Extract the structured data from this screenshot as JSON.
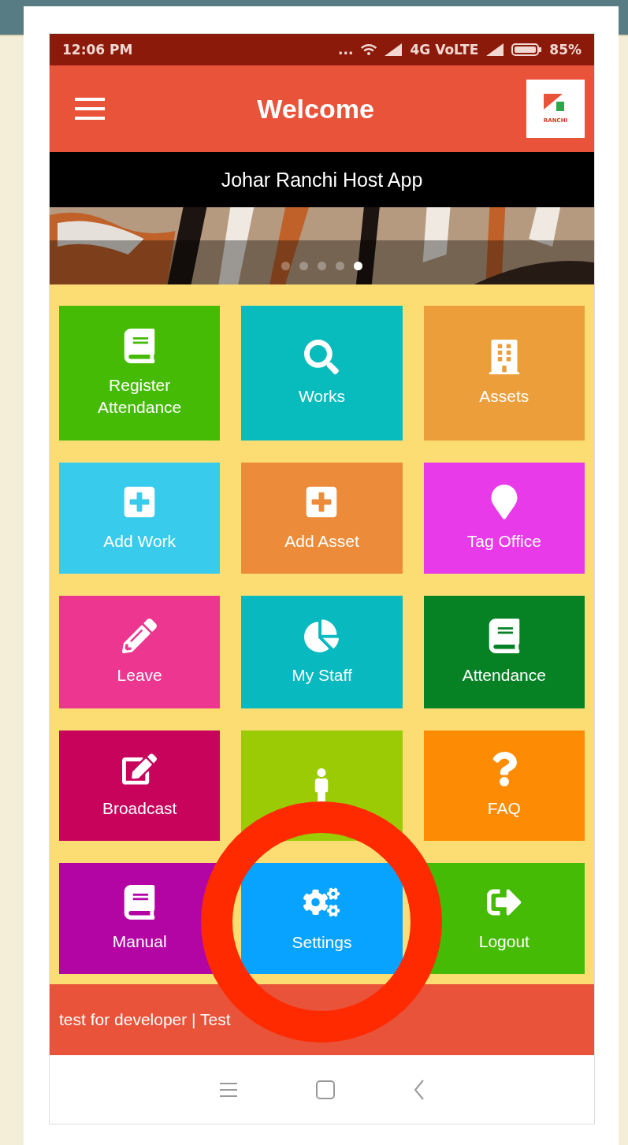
{
  "status_bar": {
    "time": "12:06 PM",
    "dots": "...",
    "network": "4G VoLTE",
    "battery": "85%"
  },
  "header": {
    "title": "Welcome",
    "logo_text": "RANCHI"
  },
  "app_title": "Johar Ranchi Host App",
  "banner": {
    "kind": "picture",
    "dots": [
      {
        "selected": false
      },
      {
        "selected": false
      },
      {
        "selected": false
      },
      {
        "selected": false
      },
      {
        "selected": true
      }
    ]
  },
  "tiles": [
    {
      "label": "Register Attendance",
      "color": "#45bb05"
    },
    {
      "label": "Works",
      "color": "#08bbbd"
    },
    {
      "label": "Assets",
      "color": "#eb9e3a"
    },
    {
      "label": "Add Work",
      "color": "#39cbec"
    },
    {
      "label": "Add Asset",
      "color": "#ec8c3a"
    },
    {
      "label": "Tag Office",
      "color": "#e83ae8"
    },
    {
      "label": "Leave",
      "color": "#ec3690"
    },
    {
      "label": "My Staff",
      "color": "#08b9c0"
    },
    {
      "label": "Attendance",
      "color": "#068225"
    },
    {
      "label": "Broadcast",
      "color": "#c8035c"
    },
    {
      "color": "#9bcb05"
    },
    {
      "label": "FAQ",
      "color": "#fe8b04"
    },
    {
      "label": "Manual",
      "color": "#b305a4"
    },
    {
      "label": "Settings",
      "color": "#08a3fe"
    },
    {
      "label": "Logout",
      "color": "#45bb05"
    }
  ],
  "ticker": "test for developer | Test",
  "annotations": [
    {
      "kind": "circle"
    }
  ]
}
